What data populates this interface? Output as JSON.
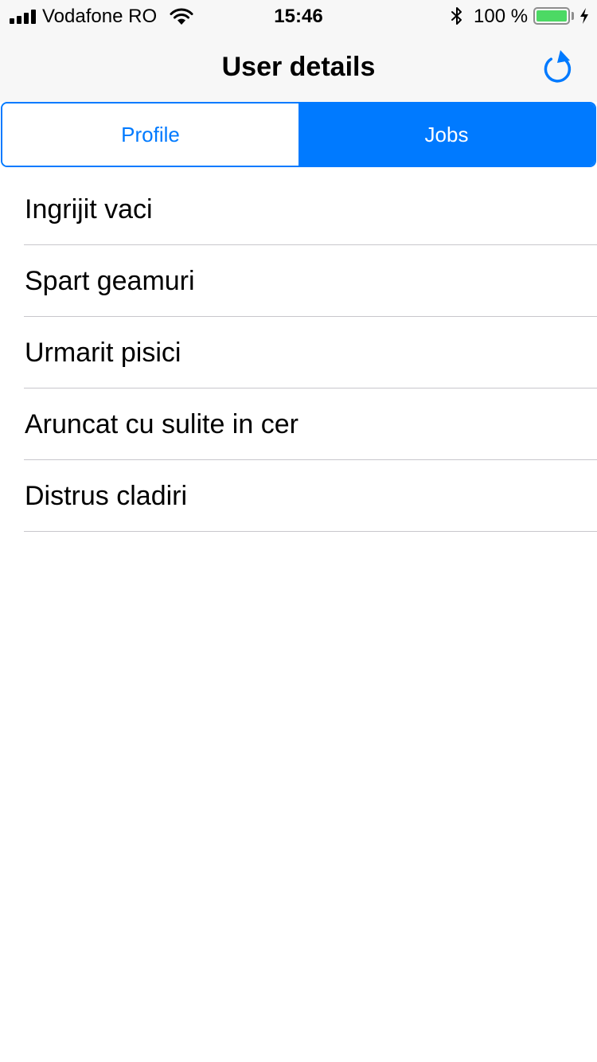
{
  "status_bar": {
    "carrier": "Vodafone RO",
    "time": "15:46",
    "battery_percent": "100 %",
    "battery_level": 1.0,
    "icons": [
      "signal-icon",
      "wifi-icon",
      "bluetooth-icon",
      "battery-icon",
      "charging-bolt-icon"
    ]
  },
  "nav": {
    "title": "User details",
    "refresh_icon": "refresh-icon"
  },
  "segmented": {
    "tabs": [
      {
        "label": "Profile",
        "selected": false
      },
      {
        "label": "Jobs",
        "selected": true
      }
    ]
  },
  "jobs": [
    {
      "label": "Ingrijit vaci"
    },
    {
      "label": "Spart geamuri"
    },
    {
      "label": "Urmarit pisici"
    },
    {
      "label": "Aruncat cu sulite in cer"
    },
    {
      "label": "Distrus cladiri"
    }
  ],
  "colors": {
    "accent": "#007aff",
    "nav_background": "#f7f7f7",
    "separator": "#c8c7cc",
    "battery_fill": "#4cd964"
  }
}
